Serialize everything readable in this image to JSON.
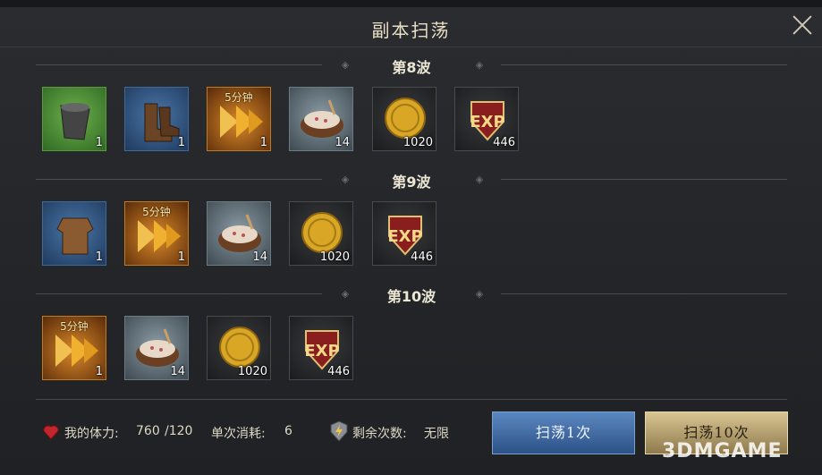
{
  "dialog": {
    "title": "副本扫荡"
  },
  "waves": [
    {
      "label": "第8波",
      "items": [
        {
          "icon": "bucket-icon",
          "qty": "1",
          "tag": ""
        },
        {
          "icon": "boots-icon",
          "qty": "1",
          "tag": ""
        },
        {
          "icon": "speedup-icon",
          "qty": "1",
          "tag": "5分钟"
        },
        {
          "icon": "food-bowl-icon",
          "qty": "14",
          "tag": ""
        },
        {
          "icon": "gold-coin-icon",
          "qty": "1020",
          "tag": ""
        },
        {
          "icon": "exp-shield-icon",
          "qty": "446",
          "tag": ""
        }
      ]
    },
    {
      "label": "第9波",
      "items": [
        {
          "icon": "armor-icon",
          "qty": "1",
          "tag": ""
        },
        {
          "icon": "speedup-icon",
          "qty": "1",
          "tag": "5分钟"
        },
        {
          "icon": "food-bowl-icon",
          "qty": "14",
          "tag": ""
        },
        {
          "icon": "gold-coin-icon",
          "qty": "1020",
          "tag": ""
        },
        {
          "icon": "exp-shield-icon",
          "qty": "446",
          "tag": ""
        }
      ]
    },
    {
      "label": "第10波",
      "items": [
        {
          "icon": "speedup-icon",
          "qty": "1",
          "tag": "5分钟"
        },
        {
          "icon": "food-bowl-icon",
          "qty": "14",
          "tag": ""
        },
        {
          "icon": "gold-coin-icon",
          "qty": "1020",
          "tag": ""
        },
        {
          "icon": "exp-shield-icon",
          "qty": "446",
          "tag": ""
        }
      ]
    }
  ],
  "footer": {
    "stamina_label": "我的体力:",
    "stamina_value": "760",
    "stamina_max": "/120",
    "cost_label": "单次消耗:",
    "cost_value": "6",
    "remaining_label": "剩余次数:",
    "remaining_value": "无限",
    "sweep1_label": "扫荡1次",
    "sweep10_label": "扫荡10次"
  },
  "watermark": "3DMGAME"
}
